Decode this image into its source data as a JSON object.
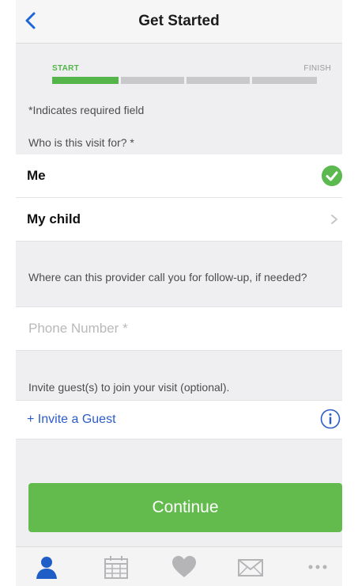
{
  "header": {
    "title": "Get Started"
  },
  "progress": {
    "start_label": "START",
    "finish_label": "FINISH",
    "completed_fraction": 0.25
  },
  "form": {
    "required_note": "*Indicates required field",
    "visit_for_label": "Who is this visit for? *",
    "options": [
      {
        "label": "Me",
        "selected": true
      },
      {
        "label": "My child",
        "selected": false
      }
    ],
    "phone_question": "Where can this provider call you for follow-up, if needed?",
    "phone_placeholder": "Phone Number *",
    "guest_label": "Invite guest(s) to join your visit (optional).",
    "invite_link": "+ Invite a Guest"
  },
  "actions": {
    "continue_label": "Continue"
  },
  "tabbar": {
    "items": [
      "person-icon",
      "calendar-icon",
      "heart-icon",
      "mail-icon",
      "more-icon"
    ],
    "active_index": 0
  },
  "colors": {
    "accent_green": "#5cb94f",
    "link_blue": "#2b5cc8",
    "back_blue": "#1e66d8"
  }
}
